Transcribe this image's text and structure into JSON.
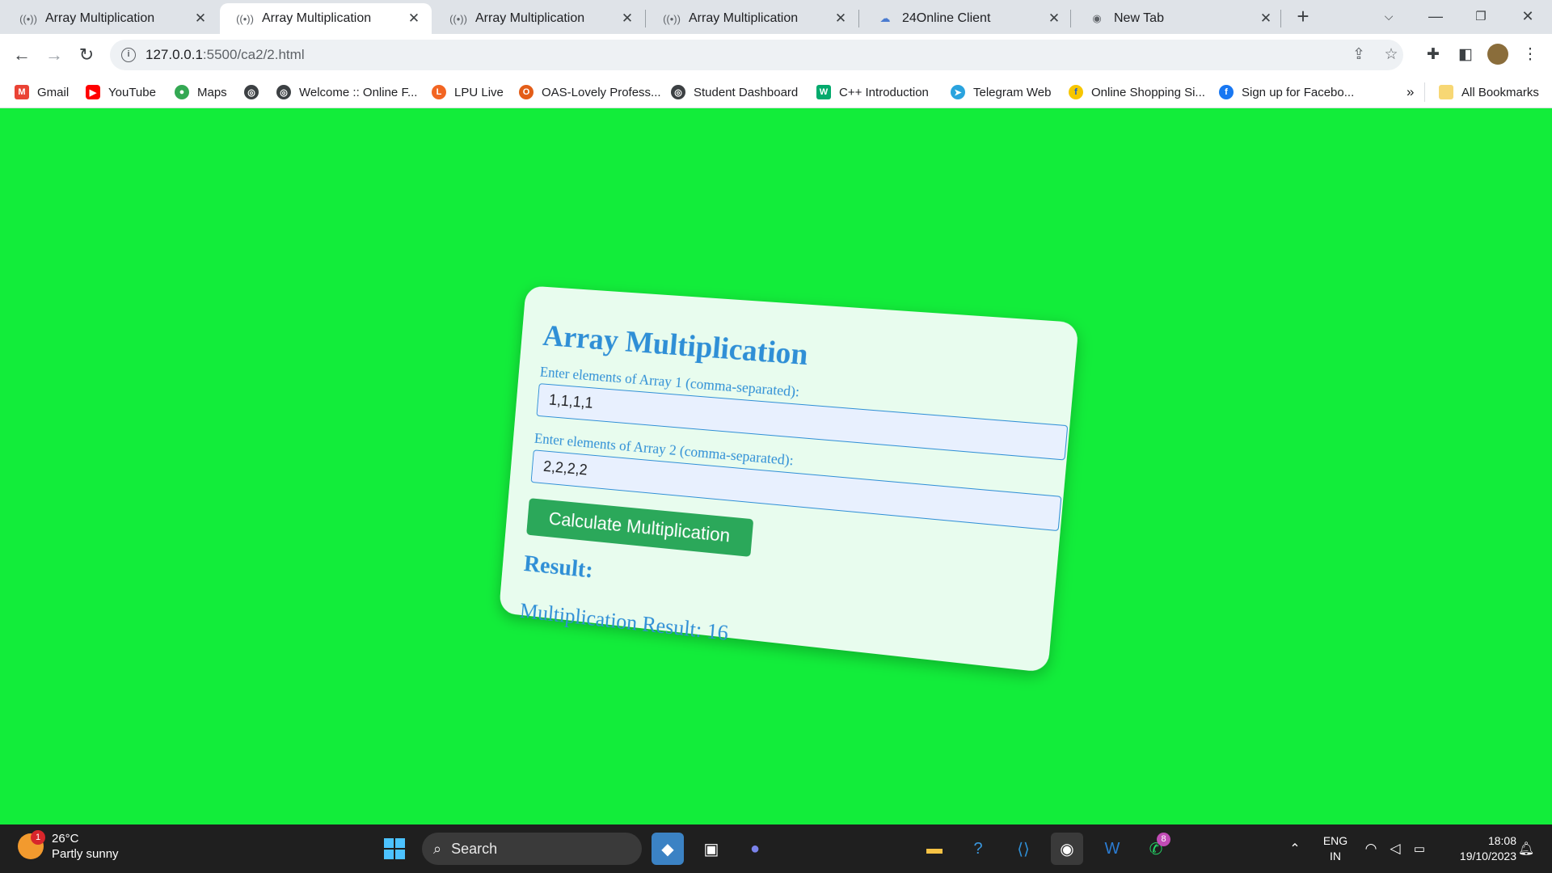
{
  "browser": {
    "tabs": [
      {
        "title": "Array Multiplication",
        "active": false
      },
      {
        "title": "Array Multiplication",
        "active": true
      },
      {
        "title": "Array Multiplication",
        "active": false
      },
      {
        "title": "Array Multiplication",
        "active": false
      },
      {
        "title": "24Online Client",
        "active": false
      },
      {
        "title": "New Tab",
        "active": false
      }
    ],
    "url_host": "127.0.0.1",
    "url_path": ":5500/ca2/2.html",
    "bookmarks": [
      {
        "label": "Gmail",
        "icon": "gmail-icon",
        "color": "#ea4335"
      },
      {
        "label": "YouTube",
        "icon": "youtube-icon",
        "color": "#ff0000"
      },
      {
        "label": "Maps",
        "icon": "maps-icon",
        "color": "#34a853"
      },
      {
        "label": "",
        "icon": "globe-icon",
        "color": "#3c4043"
      },
      {
        "label": "Welcome :: Online F...",
        "icon": "globe-icon",
        "color": "#3c4043"
      },
      {
        "label": "LPU Live",
        "icon": "lpu-live-icon",
        "color": "#f26522"
      },
      {
        "label": "OAS-Lovely Profess...",
        "icon": "oas-icon",
        "color": "#e35d18"
      },
      {
        "label": "Student Dashboard",
        "icon": "globe-icon",
        "color": "#3c4043"
      },
      {
        "label": "C++ Introduction",
        "icon": "w3schools-icon",
        "color": "#04aa6d"
      },
      {
        "label": "Telegram Web",
        "icon": "telegram-icon",
        "color": "#2aa3de"
      },
      {
        "label": "Online Shopping Si...",
        "icon": "flipkart-icon",
        "color": "#f7c600"
      },
      {
        "label": "Sign up for Facebo...",
        "icon": "facebook-icon",
        "color": "#1877f2"
      }
    ],
    "bookmarks_overflow": "»",
    "all_bookmarks": "All Bookmarks"
  },
  "page": {
    "title": "Array Multiplication",
    "array1_label": "Enter elements of Array 1 (comma-separated):",
    "array1_value": "1,1,1,1",
    "array2_label": "Enter elements of Array 2 (comma-separated):",
    "array2_value": "2,2,2,2",
    "button_label": "Calculate Multiplication",
    "result_heading": "Result:",
    "result_text": "Multiplication Result: 16",
    "colors": {
      "background": "#12ed3a",
      "card": "#e8fcee",
      "accent": "#2f8fd6",
      "button": "#2ba85a"
    }
  },
  "taskbar": {
    "weather_temp": "26°C",
    "weather_desc": "Partly sunny",
    "weather_badge": "1",
    "search_label": "Search",
    "whatsapp_badge": "8",
    "lang_top": "ENG",
    "lang_bottom": "IN",
    "time": "18:08",
    "date": "19/10/2023"
  }
}
